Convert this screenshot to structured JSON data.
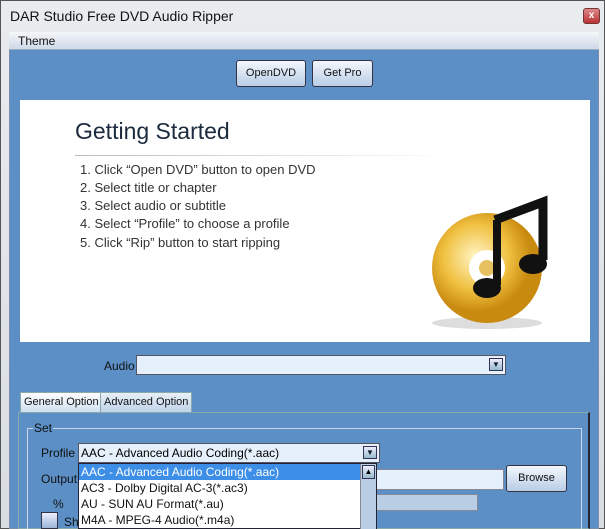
{
  "window": {
    "title": "DAR Studio Free DVD Audio Ripper",
    "close": "x"
  },
  "menu": {
    "theme": "Theme"
  },
  "toolbar": {
    "open_dvd": "OpenDVD",
    "get_pro": "Get Pro"
  },
  "getting_started": {
    "title": "Getting Started",
    "steps": [
      "1. Click “Open DVD” button to open DVD",
      "2. Select title or chapter",
      "3. Select audio or subtitle",
      "4. Select “Profile” to choose a profile",
      "5. Click “Rip” button to start ripping"
    ]
  },
  "audio": {
    "label": "Audio",
    "value": ""
  },
  "tabs": [
    "General Option",
    "Advanced Option"
  ],
  "set": {
    "group": "Set",
    "profile_label": "Profile",
    "profile_value": "AAC - Advanced Audio Coding(*.aac)",
    "output_label": "Output",
    "percent_label": "%",
    "checkbox_label": "Sh",
    "browse": "Browse",
    "options": [
      "AAC - Advanced Audio Coding(*.aac)",
      "AC3 - Dolby Digital AC-3(*.ac3)",
      "AU - SUN AU Format(*.au)",
      "M4A - MPEG-4 Audio(*.m4a)"
    ]
  }
}
